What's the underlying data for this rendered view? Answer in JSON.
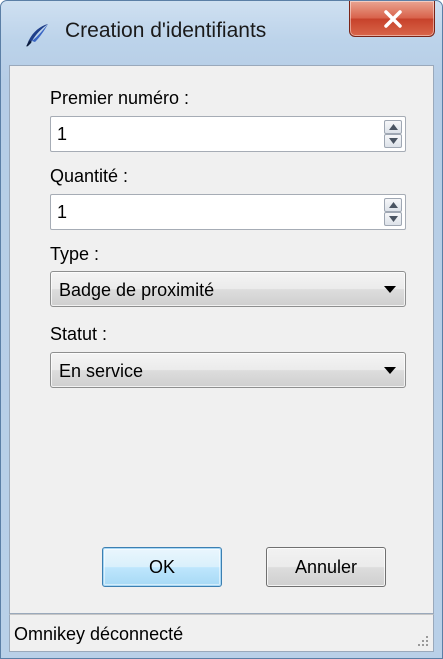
{
  "window": {
    "title": "Creation d'identifiants",
    "icon": "feather-pen-icon",
    "close_icon": "close-x-icon",
    "accent_color": "#c7422b"
  },
  "form": {
    "first_number": {
      "label": "Premier numéro :",
      "value": "1"
    },
    "quantity": {
      "label": "Quantité :",
      "value": "1"
    },
    "type": {
      "label": "Type :",
      "selected": "Badge de proximité"
    },
    "status": {
      "label": "Statut :",
      "selected": "En service"
    }
  },
  "buttons": {
    "ok": "OK",
    "cancel": "Annuler"
  },
  "statusbar": {
    "text": "Omnikey déconnecté"
  }
}
